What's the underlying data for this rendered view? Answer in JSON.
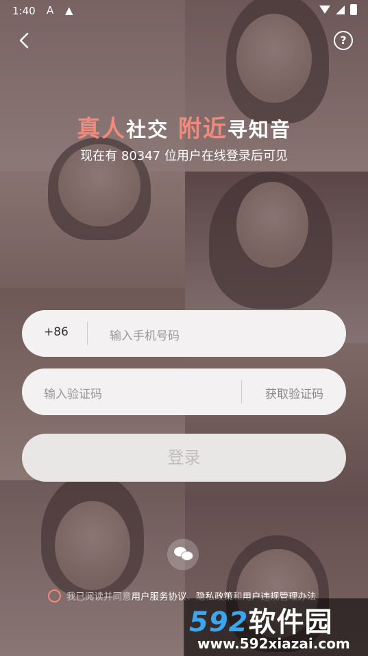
{
  "status_bar": {
    "time": "1:40",
    "icon_a": "A",
    "icon_warning": "▲"
  },
  "header": {
    "back_icon": "chevron-left",
    "help_symbol": "?"
  },
  "headline": {
    "part1_highlight": "真人",
    "part2": "社交",
    "part3_highlight": "附近",
    "part4": "寻知音",
    "subtitle": "现在有 80347 位用户在线登录后可见"
  },
  "phone_field": {
    "country_code": "+86",
    "placeholder": "输入手机号码"
  },
  "code_field": {
    "placeholder": "输入验证码",
    "get_code_label": "获取验证码"
  },
  "login_button": {
    "label": "登录"
  },
  "agreement": {
    "prefix": "我已阅读并同意",
    "link1": "用户服务协议",
    "sep1": "、",
    "link2": "隐私政策",
    "sep2": "和",
    "link3": "用户违规管理办法"
  },
  "watermark": {
    "brand_num": "592",
    "brand_cn": "软件园",
    "url": "www.592xiazai.com"
  },
  "colors": {
    "accent": "#f08a7c",
    "watermark_blue": "#3aa6ee"
  }
}
